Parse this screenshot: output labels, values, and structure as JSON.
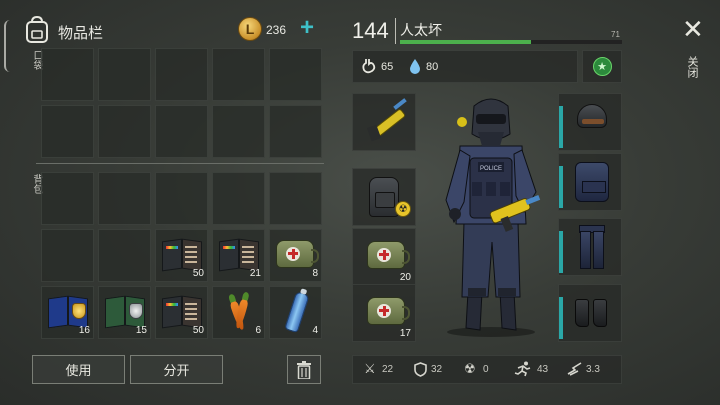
{
  "inventory": {
    "title": "物品栏",
    "pocket_label": "口袋",
    "backpack_label": "背包",
    "coins": "236",
    "add_symbol": "+"
  },
  "slots": {
    "r3c3": "50",
    "r3c4": "21",
    "r3c5": "8",
    "r4c1": "16",
    "r4c2": "15",
    "r4c3": "50",
    "r4c4": "6",
    "r4c5": "4"
  },
  "buttons": {
    "use": "使用",
    "split": "分开"
  },
  "player": {
    "level": "144",
    "name": "人太坏",
    "xp_number": "71",
    "xp_fraction": 0.59,
    "hunger": "65",
    "thirst": "80"
  },
  "equipment": {
    "weapon_medkit_1_count": "20",
    "weapon_medkit_2_count": "17"
  },
  "bottom_stats": {
    "attack": "22",
    "defense": "32",
    "radiation": "0",
    "speed": "43",
    "noise": "3.3"
  },
  "close": {
    "label": "关闭",
    "symbol": "✕"
  },
  "colors": {
    "accent_teal": "#2aa7a7",
    "xp_green": "#4cb04c",
    "coin_gold": "#e0a83a"
  },
  "icons": [
    "backpack-icon",
    "coin-icon",
    "add-icon",
    "trash-icon",
    "stomach-icon",
    "water-drop-icon",
    "star-icon",
    "close-icon",
    "sword-icon",
    "shield-icon",
    "radiation-icon",
    "run-icon",
    "noise-icon"
  ]
}
